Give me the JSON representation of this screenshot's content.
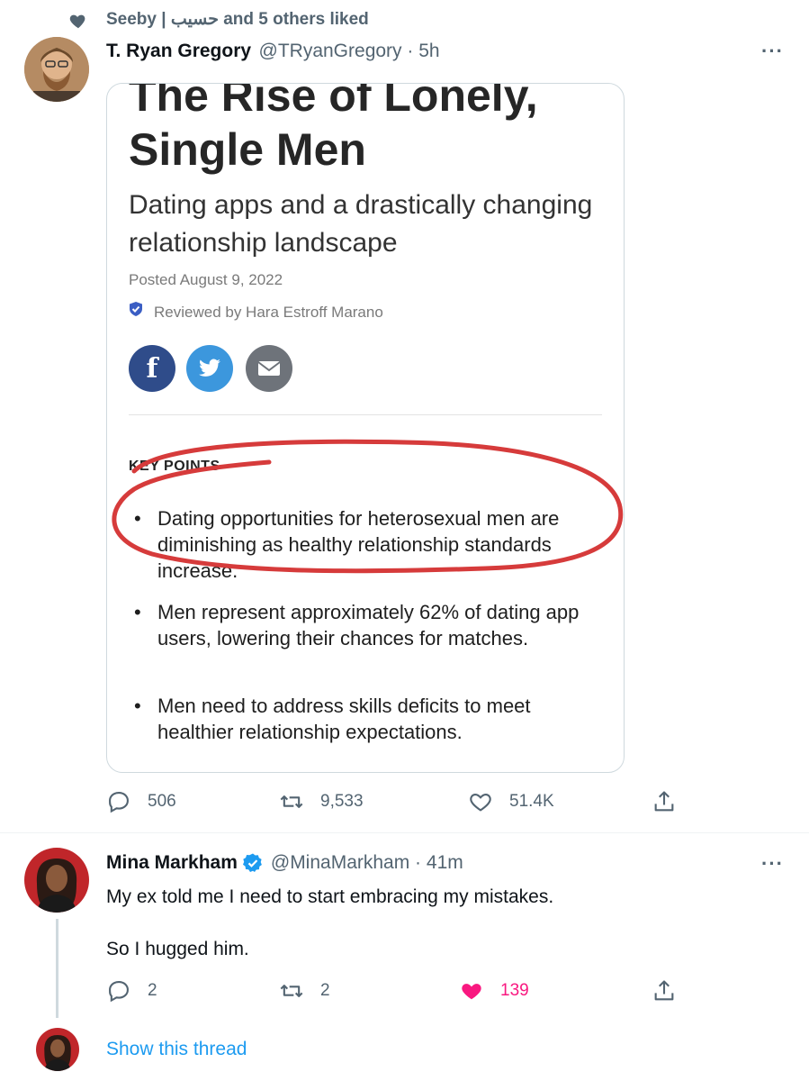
{
  "social_context": {
    "text": "Seeby | حسيب and 5 others liked"
  },
  "tweet1": {
    "name": "T. Ryan Gregory",
    "handle_time": "@TRyanGregory · 5h",
    "more": "···",
    "article": {
      "title_line1": "The Rise of Lonely,",
      "title_line2": "Single Men",
      "subtitle": "Dating apps and a drastically changing relationship landscape",
      "posted": "Posted August 9, 2022",
      "reviewed": "Reviewed by Hara Estroff Marano",
      "key_points_label": "KEY POINTS",
      "points": [
        "Dating opportunities for heterosexual men are diminishing as healthy relationship standards increase.",
        "Men represent approximately 62% of dating app users, lowering their chances for matches.",
        "Men need to address skills deficits to meet healthier relationship expectations."
      ]
    },
    "actions": {
      "replies": "506",
      "retweets": "9,533",
      "likes": "51.4K"
    }
  },
  "tweet2": {
    "name": "Mina Markham",
    "handle_time": "@MinaMarkham · 41m",
    "more": "···",
    "line1": "My ex told me I need to start embracing my mistakes.",
    "line2": "So I hugged him.",
    "actions": {
      "replies": "2",
      "retweets": "2",
      "likes": "139"
    }
  },
  "show_thread": {
    "label": "Show this thread"
  },
  "colors": {
    "link": "#1d9bf0",
    "liked": "#f91880",
    "muted": "#536471",
    "circle": "#d63b3b"
  }
}
